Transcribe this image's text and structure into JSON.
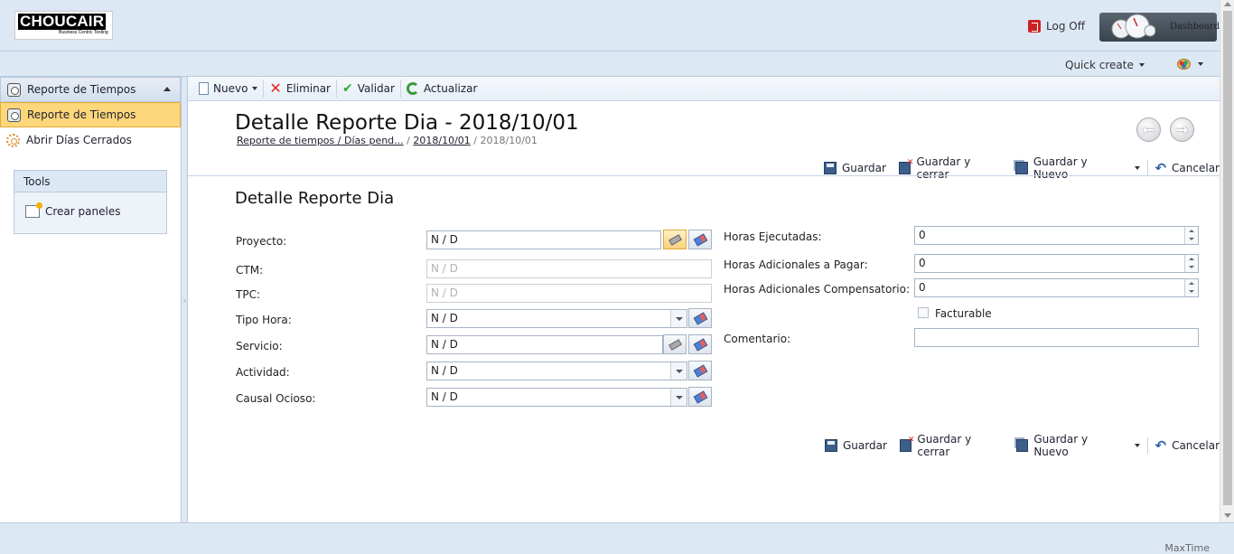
{
  "header": {
    "logo_text": "CHOUCAIR",
    "logo_tagline": "Business Centric Testing",
    "logoff_label": "Log Off",
    "dashboard_label": "Dashboard"
  },
  "subheader": {
    "quick_create_label": "Quick create"
  },
  "sidebar": {
    "group_title": "Reporte de Tiempos",
    "items": [
      {
        "label": "Reporte de Tiempos",
        "active": true
      },
      {
        "label": "Abrir Días Cerrados",
        "active": false
      }
    ],
    "tools": {
      "title": "Tools",
      "items": [
        {
          "label": "Crear paneles"
        }
      ]
    }
  },
  "toolbar": {
    "new_label": "Nuevo",
    "delete_label": "Eliminar",
    "validate_label": "Validar",
    "refresh_label": "Actualizar"
  },
  "main": {
    "title": "Detalle Reporte Dia - 2018/10/01",
    "breadcrumb": [
      "Reporte de tiempos / Días pend...",
      "2018/10/01",
      "2018/10/01"
    ],
    "breadcrumb_sep": "/",
    "actions": {
      "save": "Guardar",
      "save_close": "Guardar y cerrar",
      "save_new": "Guardar y Nuevo",
      "cancel": "Cancelar"
    },
    "section_title": "Detalle Reporte Dia"
  },
  "form": {
    "left": {
      "proyecto": {
        "label": "Proyecto:",
        "value": "N / D"
      },
      "ctm": {
        "label": "CTM:",
        "placeholder": "N / D"
      },
      "tpc": {
        "label": "TPC:",
        "placeholder": "N / D"
      },
      "tipo_hora": {
        "label": "Tipo Hora:",
        "value": "N / D"
      },
      "servicio": {
        "label": "Servicio:",
        "value": "N / D"
      },
      "actividad": {
        "label": "Actividad:",
        "value": "N / D"
      },
      "causal_ocioso": {
        "label": "Causal Ocioso:",
        "value": "N / D"
      }
    },
    "right": {
      "horas_ejecutadas": {
        "label": "Horas Ejecutadas:",
        "value": "0"
      },
      "horas_adicionales_pagar": {
        "label": "Horas Adicionales a Pagar:",
        "value": "0"
      },
      "horas_adicionales_comp": {
        "label": "Horas Adicionales Compensatorio:",
        "value": "0"
      },
      "facturable": {
        "label": "Facturable",
        "checked": false
      },
      "comentario": {
        "label": "Comentario:",
        "value": ""
      }
    }
  },
  "footer": {
    "brand": "MaxTime"
  },
  "colors": {
    "header_bg": "#dde8f5",
    "active_item_bg": "#fdd77a",
    "border": "#b9c9dc"
  }
}
